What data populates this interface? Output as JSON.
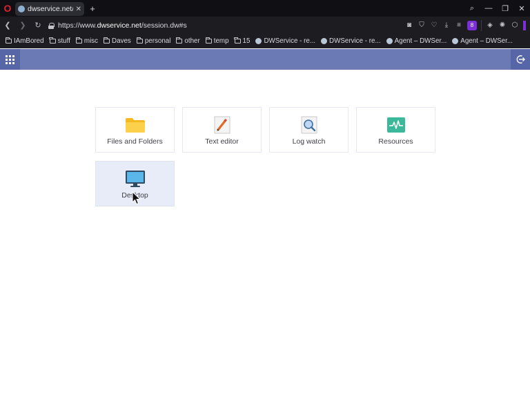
{
  "browser": {
    "tab_title": "dwservice.net/session",
    "url_prefix": "https://www.",
    "url_domain": "dwservice.net",
    "url_path": "/session.dw#s",
    "bookmarks": [
      {
        "label": "IAmBored",
        "type": "folder"
      },
      {
        "label": "stuff",
        "type": "folder"
      },
      {
        "label": "misc",
        "type": "folder"
      },
      {
        "label": "Daves",
        "type": "folder"
      },
      {
        "label": "personal",
        "type": "folder"
      },
      {
        "label": "other",
        "type": "folder"
      },
      {
        "label": "temp",
        "type": "folder"
      },
      {
        "label": "15",
        "type": "folder"
      },
      {
        "label": "DWService - re...",
        "type": "site"
      },
      {
        "label": "DWService - re...",
        "type": "site"
      },
      {
        "label": "Agent – DWSer...",
        "type": "site"
      },
      {
        "label": "Agent – DWSer...",
        "type": "site"
      }
    ]
  },
  "appbar": {
    "color": "#6b79b5",
    "apps_icon": "grid-icon",
    "logout_icon": "logout-icon"
  },
  "tiles": [
    {
      "label": "Files and Folders",
      "icon": "folder-icon"
    },
    {
      "label": "Text editor",
      "icon": "text-editor-icon"
    },
    {
      "label": "Log watch",
      "icon": "log-watch-icon"
    },
    {
      "label": "Resources",
      "icon": "resources-icon"
    },
    {
      "label": "Desktop",
      "icon": "desktop-icon"
    }
  ]
}
